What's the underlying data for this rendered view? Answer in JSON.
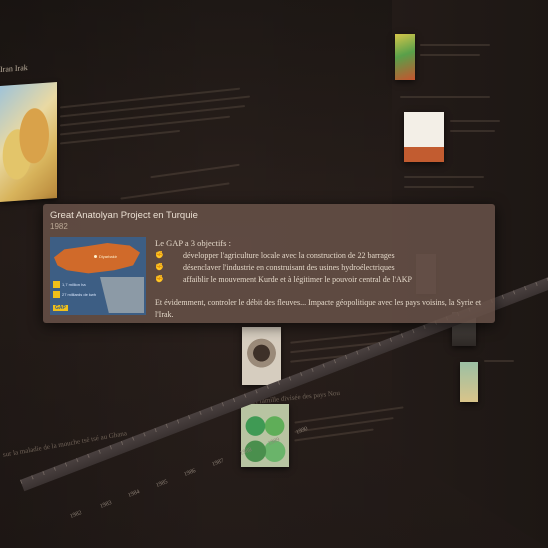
{
  "background_headings": {
    "map_title": "Iran Irak"
  },
  "popup": {
    "title": "Great Anatolyan Project en Turquie",
    "date": "1982",
    "intro": "Le GAP a 3 objectifs :",
    "objectives": [
      "développer l'agriculture locale avec la construction de 22 barrages",
      "désenclaver l'industrie en construisant des usines hydroélectriques",
      "affaiblir le mouvement Kurde et à légitimer le pouvoir central de l'AKP"
    ],
    "bullet_icon": "fist-icon",
    "paragraph": "Et évidemment, controler le débit des fleuves... Impacte géopolitique avec les pays voisins, la Syrie et l'Irak.",
    "image": {
      "city_label": "Diyarbakir",
      "legend_1": "1,7 million ha",
      "legend_2": "27 milliards de kwh",
      "badge": "GAP"
    }
  },
  "floor": {
    "left_caption": "sur la maladie de la mouche tsé tsé au Ghana",
    "fields_caption": "Sahel famille divisée des pays Nou",
    "years": [
      "1982",
      "1983",
      "1984",
      "1985",
      "1986",
      "1987",
      "1988",
      "1989",
      "1990"
    ]
  },
  "colors": {
    "background": "#211a17",
    "card": "#685248",
    "text": "#e3d7c8"
  }
}
